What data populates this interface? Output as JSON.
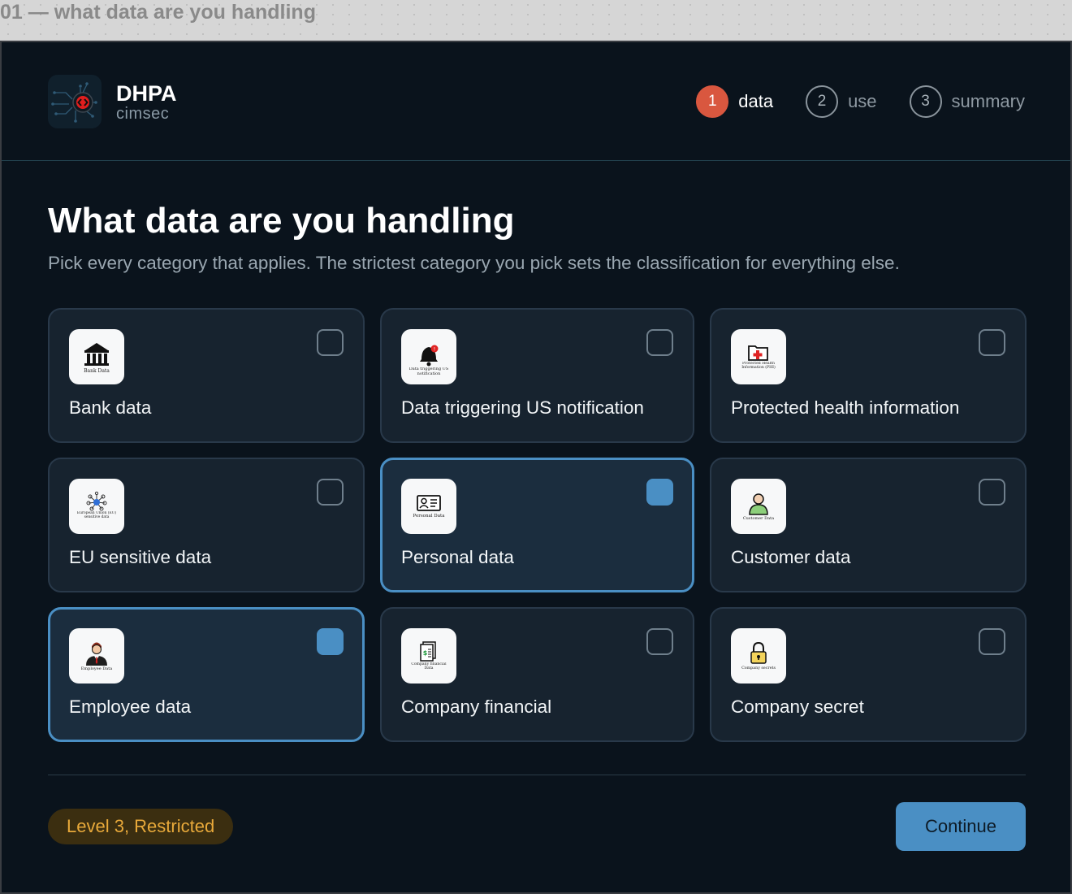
{
  "caption": "01 — what data are you handling",
  "brand": {
    "name": "DHPA",
    "sub": "cimsec"
  },
  "steps": [
    {
      "num": "1",
      "label": "data",
      "active": true
    },
    {
      "num": "2",
      "label": "use",
      "active": false
    },
    {
      "num": "3",
      "label": "summary",
      "active": false
    }
  ],
  "page": {
    "title": "What data are you handling",
    "subtitle": "Pick every category that applies. The strictest category you pick sets the classification for everything else."
  },
  "cards": [
    {
      "label": "Bank data",
      "icon": "bank-icon",
      "icon_text": "Bank Data",
      "selected": false
    },
    {
      "label": "Data triggering US notification",
      "icon": "alert-bell-icon",
      "icon_text": "Data triggering US notification",
      "selected": false
    },
    {
      "label": "Protected health information",
      "icon": "medical-folder-icon",
      "icon_text": "Protected Health Information (PHI)",
      "selected": false
    },
    {
      "label": "EU sensitive data",
      "icon": "network-nodes-icon",
      "icon_text": "European Union (EU) sensitive data",
      "selected": false
    },
    {
      "label": "Personal data",
      "icon": "id-card-icon",
      "icon_text": "Personal Data",
      "selected": true
    },
    {
      "label": "Customer data",
      "icon": "customer-person-icon",
      "icon_text": "Customer Data",
      "selected": false
    },
    {
      "label": "Employee data",
      "icon": "employee-person-icon",
      "icon_text": "Employee Data",
      "selected": true
    },
    {
      "label": "Company financial",
      "icon": "financial-document-icon",
      "icon_text": "Company financial Data",
      "selected": false
    },
    {
      "label": "Company secret",
      "icon": "padlock-icon",
      "icon_text": "Company secrets",
      "selected": false
    }
  ],
  "footer": {
    "level": "Level 3, Restricted",
    "continue_label": "Continue"
  },
  "colors": {
    "background": "#0a131c",
    "card": "#17232f",
    "card_selected": "#1b2d3e",
    "accent": "#4a8fc4",
    "step_active": "#d9573f",
    "badge_text": "#e8a93a",
    "badge_bg": "#3b2e10"
  }
}
